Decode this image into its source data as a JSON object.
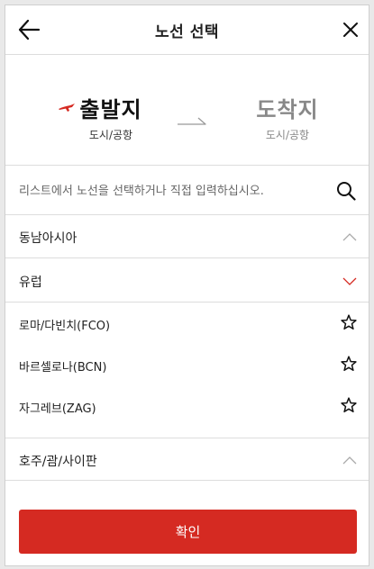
{
  "header": {
    "title": "노선 선택"
  },
  "route": {
    "origin_label": "출발지",
    "origin_sub": "도시/공항",
    "dest_label": "도착지",
    "dest_sub": "도시/공항"
  },
  "search": {
    "placeholder": "리스트에서 노선을 선택하거나 직접 입력하십시오."
  },
  "regions": [
    {
      "label": "동남아시아",
      "expanded": false
    },
    {
      "label": "유럽",
      "expanded": true
    },
    {
      "label": "호주/괌/사이판",
      "expanded": false
    }
  ],
  "europe_cities": [
    {
      "label": "로마/다빈치(FCO)",
      "favorite": false
    },
    {
      "label": "바르셀로나(BCN)",
      "favorite": false
    },
    {
      "label": "자그레브(ZAG)",
      "favorite": false
    }
  ],
  "confirm_label": "확인",
  "colors": {
    "accent": "#d52a22",
    "muted": "#888888"
  },
  "icons": {
    "back": "arrow-left-icon",
    "close": "close-icon",
    "plane": "plane-icon",
    "route_arrow": "arrow-right-icon",
    "search": "search-icon",
    "collapsed": "chevron-up-icon",
    "expanded": "chevron-down-icon",
    "favorite": "star-outline-icon"
  }
}
